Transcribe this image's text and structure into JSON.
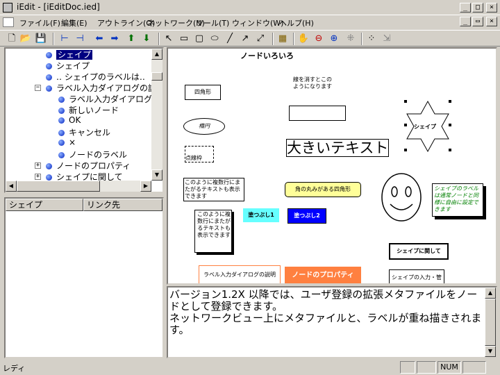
{
  "window": {
    "title": "iEdit - [iEditDoc.ied]",
    "app_icon_text": "iEdit"
  },
  "menu": {
    "file": "ファイル(F)",
    "edit": "編集(E)",
    "outline": "アウトライン(O)",
    "network": "ネットワーク(N)",
    "tools": "ツール(T)",
    "window": "ウィンドウ(W)",
    "help": "ヘルプ(H)"
  },
  "tree": {
    "items": [
      {
        "label": "シェイプ",
        "selected": true
      },
      {
        "label": "シェイプ"
      },
      {
        "label": "‥ シェイプのラベルは‥"
      },
      {
        "label": "ラベル入力ダイアログの説"
      },
      {
        "label": "ラベル入力ダイアログ"
      },
      {
        "label": "新しいノード"
      },
      {
        "label": "OK"
      },
      {
        "label": "キャンセル"
      },
      {
        "label": "×"
      },
      {
        "label": "ノードのラベル"
      },
      {
        "label": "ノードのプロパティ"
      },
      {
        "label": "シェイプに関して"
      }
    ]
  },
  "link_panel": {
    "col_shape": "シェイプ",
    "col_link": "リンク先"
  },
  "canvas": {
    "title": "ノードいろいろ",
    "rect_label": "四角形",
    "ellipse_label": "楕円",
    "dotted_label": "点線枠",
    "big_text": "大きいテキスト",
    "frameless_text": "線を消すとこのようになります",
    "multiline_text": "このように複数行にまたがるテキストも表示できます",
    "multiline_text2": "このように複数行にまたがるテキストも表示できます",
    "rounded_label": "角の丸みがある四角形",
    "fill1": "塗つぶし1",
    "fill2": "塗つぶし2",
    "star_label": "シェイプ",
    "shape_note": "シェイプのラベルは通常ノードと同様に自由に設定できます",
    "about_shapes": "シェイプに関して",
    "label_dialog_desc": "ラベル入力ダイアログの説明",
    "node_props": "ノードのプロパティ",
    "shape_io": "シェイプの入力・管理画面"
  },
  "text_pane": {
    "content": "バージョン1.2X 以降では、ユーザ登録の拡張メタファイルをノードとして登録できます。\nネットワークビュー上にメタファイルと、ラベルが重ね描きされます。"
  },
  "status": {
    "text": "レディ",
    "num": "NUM"
  },
  "colors": {
    "selection": "#000080",
    "fill1": "#66ffff",
    "fill2": "#0000ff",
    "rounded_fill": "#ffff99",
    "orange": "#ff8040",
    "note_text": "#008000",
    "note_fill": "#ccffcc"
  },
  "icons": [
    "new-file-icon",
    "open-folder-icon",
    "save-icon",
    "outline-left-icon",
    "outline-right-icon",
    "arrow-left-icon",
    "arrow-right-icon",
    "arrow-up-icon",
    "arrow-down-icon",
    "select-pointer-icon",
    "rectangle-tool-icon",
    "rounded-rect-tool-icon",
    "ellipse-tool-icon",
    "line-tool-icon",
    "arrow-line-tool-icon",
    "double-arrow-line-tool-icon",
    "network-view-icon",
    "hand-icon",
    "zoom-out-icon",
    "zoom-in-icon",
    "fit-icon",
    "grid-icon",
    "link-icon"
  ]
}
